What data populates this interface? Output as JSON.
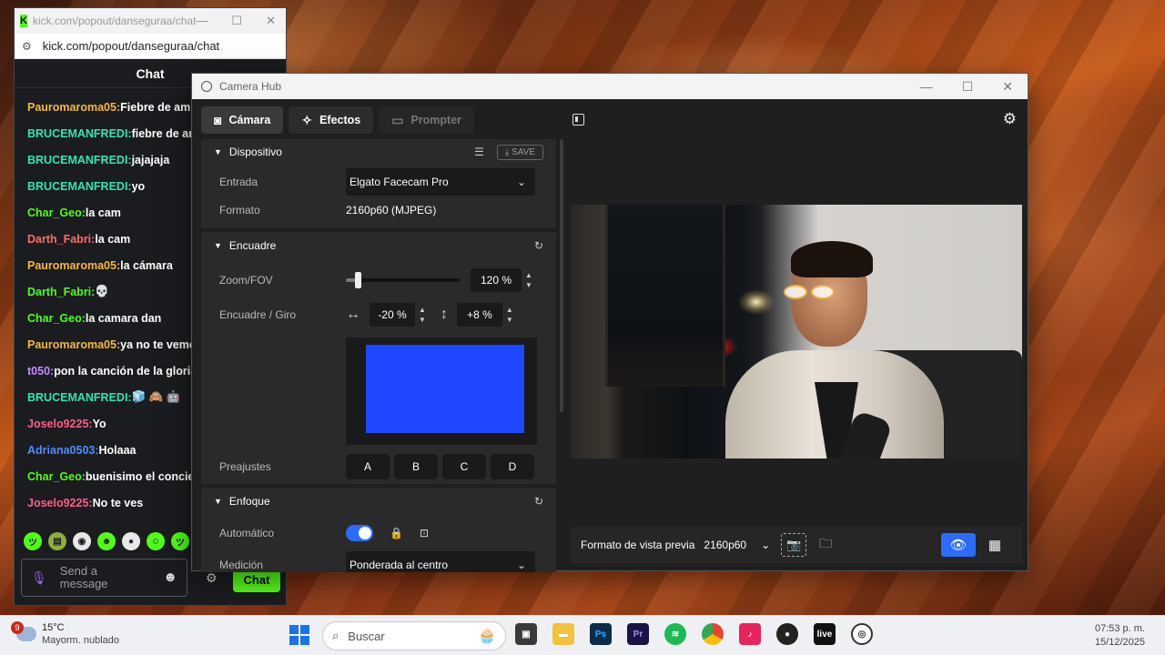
{
  "kick": {
    "tab_title": "kick.com/popout/danseguraa/chat",
    "url": "kick.com/popout/danseguraa/chat",
    "header": "Chat",
    "messages": [
      {
        "user": "Pauromaroma05:",
        "text": " Fiebre de am",
        "color": "#f5b83d"
      },
      {
        "user": "BRUCEMANFREDI:",
        "text": " fiebre de an",
        "color": "#2ee6b0"
      },
      {
        "user": "BRUCEMANFREDI:",
        "text": " jajajaja",
        "color": "#2ee6b0"
      },
      {
        "user": "BRUCEMANFREDI:",
        "text": " yo",
        "color": "#2ee6b0"
      },
      {
        "user": "Char_Geo:",
        "text": " la cam",
        "color": "#53fc18"
      },
      {
        "user": "Darth_Fabri:",
        "text": " la cam",
        "color": "#ff6b6b"
      },
      {
        "user": "Pauromaroma05:",
        "text": " la cámara",
        "color": "#f5b83d"
      },
      {
        "user": "Darth_Fabri:",
        "text": " 💀",
        "color": "#53fc18"
      },
      {
        "user": "Char_Geo:",
        "text": " la camara dan",
        "color": "#53fc18"
      },
      {
        "user": "Pauromaroma05:",
        "text": " ya no te veme",
        "color": "#f5b83d"
      },
      {
        "user": "t050:",
        "text": " pon la canción de la gloria",
        "color": "#c58bff"
      },
      {
        "user": "BRUCEMANFREDI:",
        "text": " 🧊 🙈 🤖",
        "color": "#2ee6b0"
      },
      {
        "user": "Joselo9225:",
        "text": " Yo",
        "color": "#ff5c8a"
      },
      {
        "user": "Adriana0503:",
        "text": " Holaaa",
        "color": "#4f8dff"
      },
      {
        "user": "Char_Geo:",
        "text": " buenisimo el concier",
        "color": "#53fc18"
      },
      {
        "user": "Joselo9225:",
        "text": " No te ves",
        "color": "#ff5c8a"
      }
    ],
    "input_placeholder": "Send a message",
    "chat_button": "Chat"
  },
  "hub": {
    "title": "Camera Hub",
    "tabs": [
      {
        "label": "Cámara",
        "state": "active"
      },
      {
        "label": "Efectos",
        "state": "normal"
      },
      {
        "label": "Prompter",
        "state": "disabled"
      }
    ],
    "dispositivo": {
      "title": "Dispositivo",
      "save_label": "SAVE",
      "entrada_label": "Entrada",
      "entrada_value": "Elgato Facecam Pro",
      "formato_label": "Formato",
      "formato_value": "2160p60 (MJPEG)"
    },
    "encuadre": {
      "title": "Encuadre",
      "zoom_label": "Zoom/FOV",
      "zoom_value": "120 %",
      "zoom_level": 0.1,
      "giro_label": "Encuadre / Giro",
      "h_value": "-20 %",
      "v_value": "+8 %",
      "presets_label": "Preajustes",
      "presets": [
        "A",
        "B",
        "C",
        "D"
      ],
      "frame_color": "#1f47ff"
    },
    "enfoque": {
      "title": "Enfoque",
      "auto_label": "Automático",
      "auto_on": true,
      "medicion_label": "Medición",
      "medicion_value": "Ponderada al centro"
    },
    "preview": {
      "format_label": "Formato de vista previa",
      "format_value": "2160p60"
    }
  },
  "taskbar": {
    "temp": "15°C",
    "weather": "Mayorm. nublado",
    "badge": "9",
    "search_placeholder": "Buscar",
    "time": "07:53 p. m.",
    "date": "15/12/2025"
  }
}
